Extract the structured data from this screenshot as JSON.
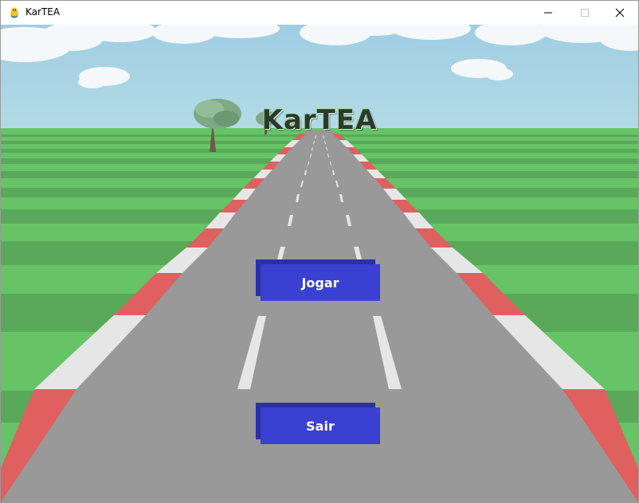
{
  "window": {
    "title": "KarTEA",
    "icon": "pygame-snake-icon",
    "controls": {
      "minimize": "minimize-icon",
      "maximize": "maximize-icon",
      "close": "close-icon"
    }
  },
  "game": {
    "title": "KarTEA",
    "buttons": {
      "play": "Jogar",
      "quit": "Sair"
    }
  },
  "colors": {
    "sky": "#a7d3e6",
    "grass_light": "#66c466",
    "grass_dark": "#5aa85a",
    "road": "#999999",
    "curb_red": "#e06060",
    "curb_white": "#e6e6e6",
    "lane_marking": "#e6e6e6",
    "button_face": "#3a40d2",
    "button_shadow": "#2b2fa8",
    "title_text": "#2c3a2c"
  }
}
